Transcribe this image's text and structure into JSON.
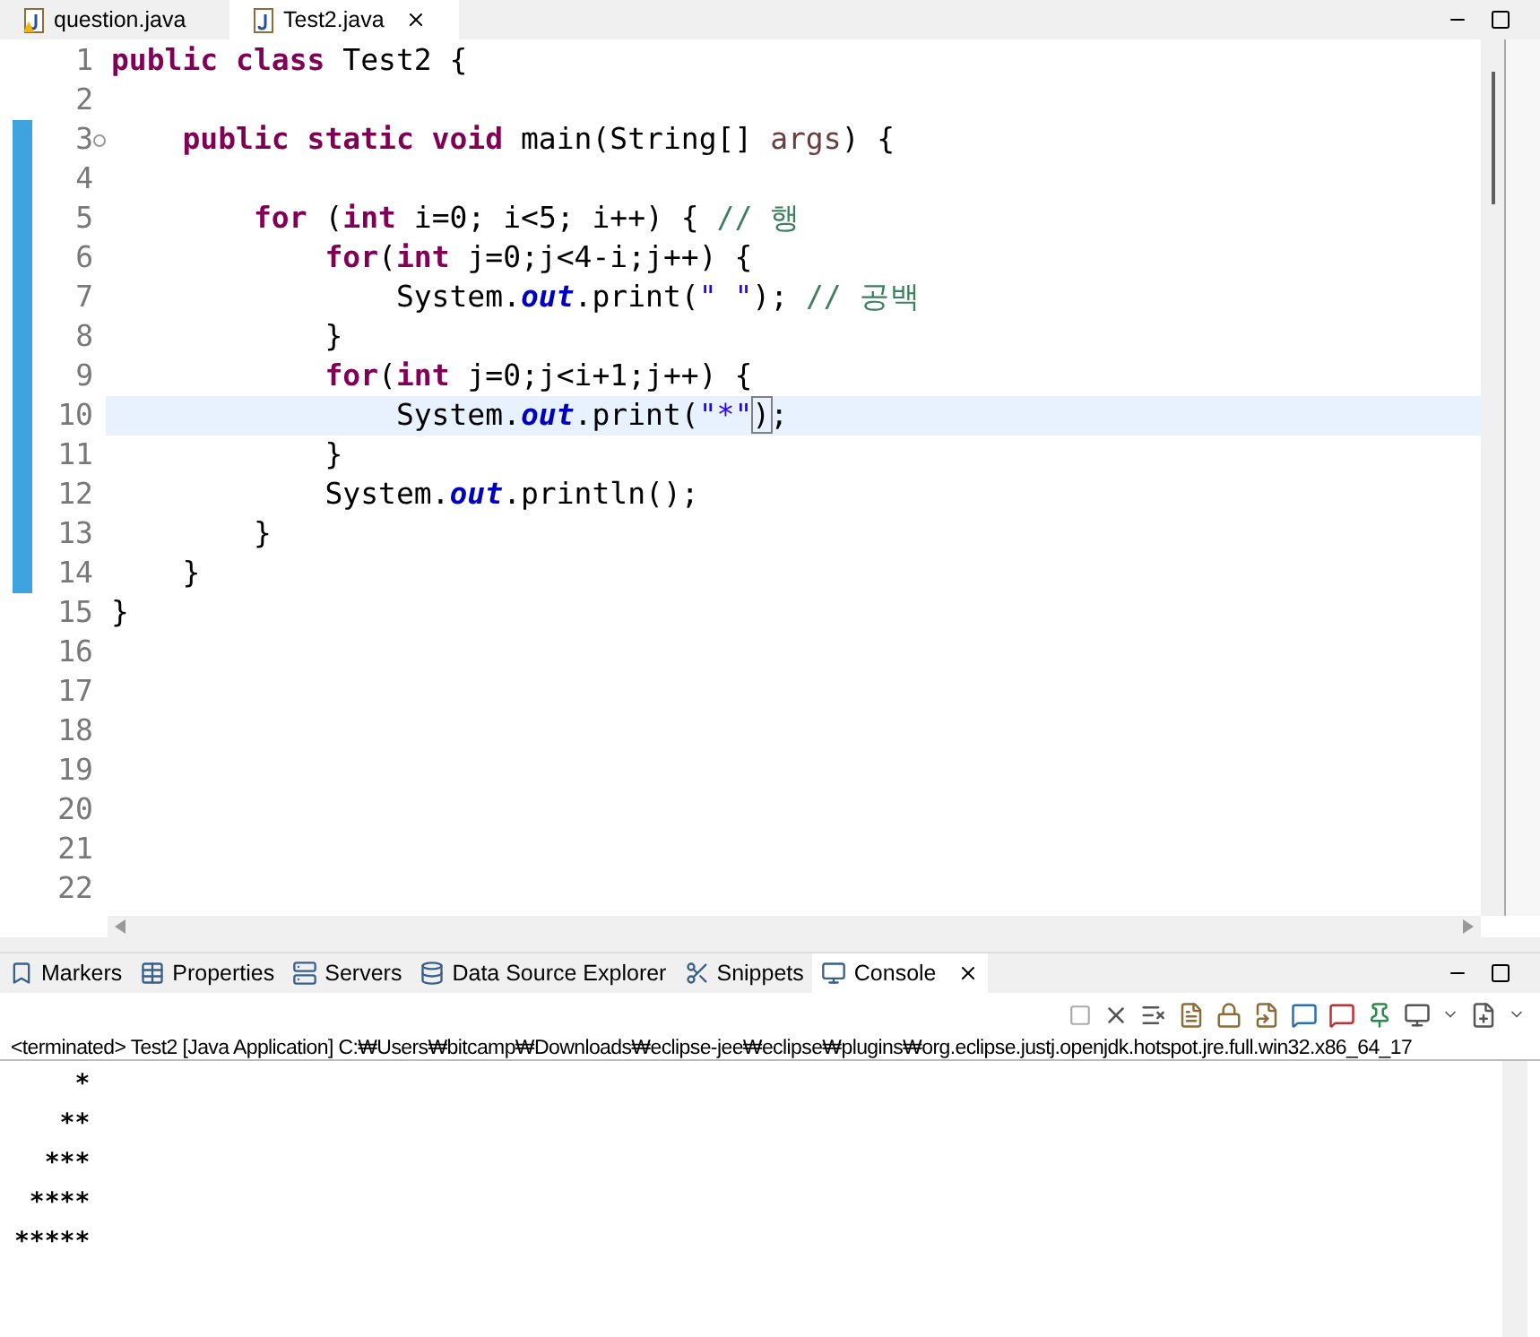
{
  "editor_tabs": [
    {
      "label": "question.java",
      "selected": false,
      "warning": true
    },
    {
      "label": "Test2.java",
      "selected": true,
      "warning": false
    }
  ],
  "code_lines": [
    {
      "number": "1",
      "changed": false,
      "current": false,
      "fold": false,
      "tokens": [
        {
          "kind": "kw",
          "text": "public class"
        },
        {
          "kind": "plain",
          "text": " Test2 {"
        }
      ]
    },
    {
      "number": "2",
      "changed": false,
      "current": false,
      "fold": false
    },
    {
      "number": "3",
      "changed": true,
      "current": false,
      "fold": true,
      "tokens": [
        {
          "kind": "kw",
          "text": "    public static void"
        },
        {
          "kind": "plain",
          "text": " main(String[] "
        },
        {
          "kind": "param",
          "text": "args"
        },
        {
          "kind": "plain",
          "text": ") {"
        }
      ]
    },
    {
      "number": "4",
      "changed": true,
      "current": false,
      "fold": false
    },
    {
      "number": "5",
      "changed": true,
      "current": false,
      "fold": false,
      "tokens": [
        {
          "kind": "kw",
          "text": "        for"
        },
        {
          "kind": "plain",
          "text": " ("
        },
        {
          "kind": "kw",
          "text": "int"
        },
        {
          "kind": "plain",
          "text": " i=0; i<5; i++) { "
        },
        {
          "kind": "comment",
          "text": "// 행"
        }
      ]
    },
    {
      "number": "6",
      "changed": true,
      "current": false,
      "fold": false,
      "tokens": [
        {
          "kind": "kw",
          "text": "            for"
        },
        {
          "kind": "plain",
          "text": "("
        },
        {
          "kind": "kw",
          "text": "int"
        },
        {
          "kind": "plain",
          "text": " j=0;j<4-i;j++) {"
        }
      ]
    },
    {
      "number": "7",
      "changed": true,
      "current": false,
      "fold": false,
      "tokens": [
        {
          "kind": "plain",
          "text": "                System."
        },
        {
          "kind": "field",
          "text": "out"
        },
        {
          "kind": "plain",
          "text": ".print("
        },
        {
          "kind": "str",
          "text": "\" \""
        },
        {
          "kind": "plain",
          "text": "); "
        },
        {
          "kind": "comment",
          "text": "// 공백"
        }
      ]
    },
    {
      "number": "8",
      "changed": true,
      "current": false,
      "fold": false,
      "tokens": [
        {
          "kind": "plain",
          "text": "            }"
        }
      ]
    },
    {
      "number": "9",
      "changed": true,
      "current": false,
      "fold": false,
      "tokens": [
        {
          "kind": "kw",
          "text": "            for"
        },
        {
          "kind": "plain",
          "text": "("
        },
        {
          "kind": "kw",
          "text": "int"
        },
        {
          "kind": "plain",
          "text": " j=0;j<i+1;j++) {"
        }
      ]
    },
    {
      "number": "10",
      "changed": true,
      "current": true,
      "fold": false,
      "tokens": [
        {
          "kind": "plain",
          "text": "                System."
        },
        {
          "kind": "field",
          "text": "out"
        },
        {
          "kind": "plain",
          "text": ".print("
        },
        {
          "kind": "str",
          "text": "\"*\""
        },
        {
          "kind": "bracket",
          "text": ")"
        },
        {
          "kind": "plain",
          "text": ";"
        }
      ]
    },
    {
      "number": "11",
      "changed": true,
      "current": false,
      "fold": false,
      "tokens": [
        {
          "kind": "plain",
          "text": "            }"
        }
      ]
    },
    {
      "number": "12",
      "changed": true,
      "current": false,
      "fold": false,
      "tokens": [
        {
          "kind": "plain",
          "text": "            System."
        },
        {
          "kind": "field",
          "text": "out"
        },
        {
          "kind": "plain",
          "text": ".println();"
        }
      ]
    },
    {
      "number": "13",
      "changed": true,
      "current": false,
      "fold": false,
      "tokens": [
        {
          "kind": "plain",
          "text": "        }"
        }
      ]
    },
    {
      "number": "14",
      "changed": true,
      "current": false,
      "fold": false,
      "tokens": [
        {
          "kind": "plain",
          "text": "    }"
        }
      ]
    },
    {
      "number": "15",
      "changed": false,
      "current": false,
      "fold": false,
      "tokens": [
        {
          "kind": "plain",
          "text": "}"
        }
      ]
    },
    {
      "number": "16",
      "changed": false,
      "current": false,
      "fold": false
    },
    {
      "number": "17",
      "changed": false,
      "current": false,
      "fold": false
    },
    {
      "number": "18",
      "changed": false,
      "current": false,
      "fold": false
    },
    {
      "number": "19",
      "changed": false,
      "current": false,
      "fold": false
    },
    {
      "number": "20",
      "changed": false,
      "current": false,
      "fold": false
    },
    {
      "number": "21",
      "changed": false,
      "current": false,
      "fold": false
    },
    {
      "number": "22",
      "changed": false,
      "current": false,
      "fold": false
    }
  ],
  "view_tabs": [
    {
      "label": "Markers",
      "kind": "markers",
      "selected": false
    },
    {
      "label": "Properties",
      "kind": "properties",
      "selected": false
    },
    {
      "label": "Servers",
      "kind": "servers",
      "selected": false
    },
    {
      "label": "Data Source Explorer",
      "kind": "datasource",
      "selected": false
    },
    {
      "label": "Snippets",
      "kind": "snippets",
      "selected": false
    },
    {
      "label": "Console",
      "kind": "console",
      "selected": true
    }
  ],
  "console": {
    "status": "<terminated> Test2 [Java Application] C:₩Users₩bitcamp₩Downloads₩eclipse-jee₩eclipse₩plugins₩org.eclipse.justj.openjdk.hotspot.jre.full.win32.x86_64_17",
    "output": [
      "    *",
      "   **",
      "  ***",
      " ****",
      "*****"
    ]
  }
}
